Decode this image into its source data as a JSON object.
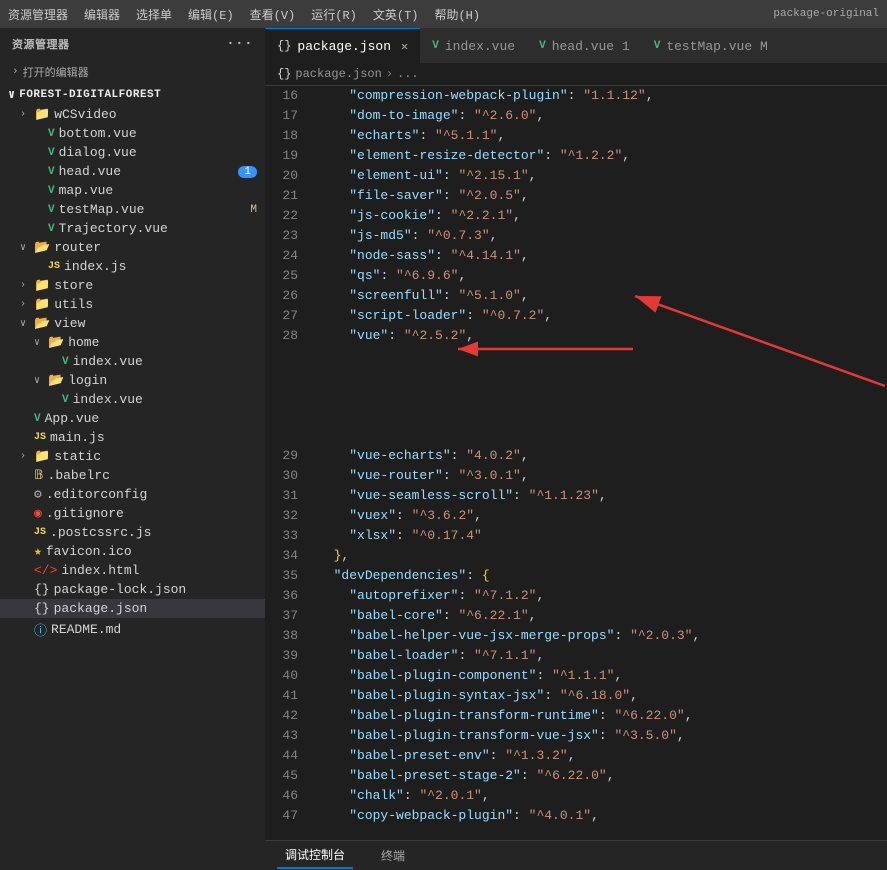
{
  "menubar": {
    "items": [
      "资源管理器",
      "编辑器",
      "选择单",
      "编辑(E)",
      "查看(V)",
      "运行(R)",
      "文英(T)",
      "帮助(H)",
      "package-original"
    ]
  },
  "sidebar": {
    "header": "资源管理器",
    "open_editors_label": "打开的编辑器",
    "project_root": "FOREST-DIGITALFOREST",
    "tree": [
      {
        "indent": 1,
        "type": "folder",
        "name": "wCSvideo",
        "collapsed": true
      },
      {
        "indent": 1,
        "type": "vue",
        "name": "bottom.vue"
      },
      {
        "indent": 1,
        "type": "vue",
        "name": "dialog.vue"
      },
      {
        "indent": 1,
        "type": "vue",
        "name": "head.vue",
        "badge": "1"
      },
      {
        "indent": 1,
        "type": "vue",
        "name": "map.vue"
      },
      {
        "indent": 1,
        "type": "vue",
        "name": "testMap.vue",
        "badge_m": "M"
      },
      {
        "indent": 1,
        "type": "vue",
        "name": "Trajectory.vue"
      },
      {
        "indent": 0,
        "type": "folder",
        "name": "router",
        "collapsed": false
      },
      {
        "indent": 1,
        "type": "js",
        "name": "index.js"
      },
      {
        "indent": 0,
        "type": "folder",
        "name": "store",
        "collapsed": true
      },
      {
        "indent": 0,
        "type": "folder",
        "name": "utils",
        "collapsed": true
      },
      {
        "indent": 0,
        "type": "folder",
        "name": "view",
        "collapsed": false
      },
      {
        "indent": 1,
        "type": "folder",
        "name": "home",
        "collapsed": false
      },
      {
        "indent": 2,
        "type": "vue",
        "name": "index.vue"
      },
      {
        "indent": 1,
        "type": "folder",
        "name": "login",
        "collapsed": false
      },
      {
        "indent": 2,
        "type": "vue",
        "name": "index.vue"
      },
      {
        "indent": 0,
        "type": "vue",
        "name": "App.vue"
      },
      {
        "indent": 0,
        "type": "js",
        "name": "main.js"
      },
      {
        "indent": 0,
        "type": "folder",
        "name": "static",
        "collapsed": true
      },
      {
        "indent": 0,
        "type": "babelrc",
        "name": ".babelrc"
      },
      {
        "indent": 0,
        "type": "editorconfig",
        "name": ".editorconfig"
      },
      {
        "indent": 0,
        "type": "gitignore",
        "name": ".gitignore"
      },
      {
        "indent": 0,
        "type": "js",
        "name": ".postcssrc.js"
      },
      {
        "indent": 0,
        "type": "favicon",
        "name": "favicon.ico"
      },
      {
        "indent": 0,
        "type": "html",
        "name": "index.html"
      },
      {
        "indent": 0,
        "type": "json",
        "name": "package-lock.json"
      },
      {
        "indent": 0,
        "type": "json",
        "name": "package.json",
        "selected": true
      },
      {
        "indent": 0,
        "type": "readme",
        "name": "README.md"
      }
    ]
  },
  "tabs": [
    {
      "name": "package.json",
      "type": "json",
      "active": true,
      "closeable": true
    },
    {
      "name": "index.vue",
      "type": "vue",
      "active": false,
      "closeable": false
    },
    {
      "name": "head.vue 1",
      "type": "vue",
      "active": false,
      "closeable": false
    },
    {
      "name": "testMap.vue M",
      "type": "vue",
      "active": false,
      "closeable": false
    }
  ],
  "breadcrumb": [
    "{} package.json",
    ">",
    "..."
  ],
  "code": {
    "lines": [
      {
        "num": 16,
        "content": "    \"compression-webpack-plugin\": \"1.1.12\","
      },
      {
        "num": 17,
        "content": "    \"dom-to-image\": \"^2.6.0\","
      },
      {
        "num": 18,
        "content": "    \"echarts\": \"^5.1.1\","
      },
      {
        "num": 19,
        "content": "    \"element-resize-detector\": \"^1.2.2\","
      },
      {
        "num": 20,
        "content": "    \"element-ui\": \"^2.15.1\","
      },
      {
        "num": 21,
        "content": "    \"file-saver\": \"^2.0.5\","
      },
      {
        "num": 22,
        "content": "    \"js-cookie\": \"^2.2.1\","
      },
      {
        "num": 23,
        "content": "    \"js-md5\": \"^0.7.3\","
      },
      {
        "num": 24,
        "content": "    \"node-sass\": \"^4.14.1\","
      },
      {
        "num": 25,
        "content": "    \"qs\": \"^6.9.6\","
      },
      {
        "num": 26,
        "content": "    \"screenfull\": \"^5.1.0\","
      },
      {
        "num": 27,
        "content": "    \"script-loader\": \"^0.7.2\","
      },
      {
        "num": 28,
        "content": "    \"vue\": \"^2.5.2\","
      },
      {
        "num": 29,
        "content": "    \"vue-echarts\": \"4.0.2\","
      },
      {
        "num": 30,
        "content": "    \"vue-router\": \"^3.0.1\","
      },
      {
        "num": 31,
        "content": "    \"vue-seamless-scroll\": \"^1.1.23\","
      },
      {
        "num": 32,
        "content": "    \"vuex\": \"^3.6.2\","
      },
      {
        "num": 33,
        "content": "    \"xlsx\": \"^0.17.4\""
      },
      {
        "num": 34,
        "content": "  },"
      },
      {
        "num": 35,
        "content": "  \"devDependencies\": {"
      },
      {
        "num": 36,
        "content": "    \"autoprefixer\": \"^7.1.2\","
      },
      {
        "num": 37,
        "content": "    \"babel-core\": \"^6.22.1\","
      },
      {
        "num": 38,
        "content": "    \"babel-helper-vue-jsx-merge-props\": \"^2.0.3\","
      },
      {
        "num": 39,
        "content": "    \"babel-loader\": \"^7.1.1\","
      },
      {
        "num": 40,
        "content": "    \"babel-plugin-component\": \"^1.1.1\","
      },
      {
        "num": 41,
        "content": "    \"babel-plugin-syntax-jsx\": \"^6.18.0\","
      },
      {
        "num": 42,
        "content": "    \"babel-plugin-transform-runtime\": \"^6.22.0\","
      },
      {
        "num": 43,
        "content": "    \"babel-plugin-transform-vue-jsx\": \"^3.5.0\","
      },
      {
        "num": 44,
        "content": "    \"babel-preset-env\": \"^1.3.2\","
      },
      {
        "num": 45,
        "content": "    \"babel-preset-stage-2\": \"^6.22.0\","
      },
      {
        "num": 46,
        "content": "    \"chalk\": \"^2.0.1\","
      },
      {
        "num": 47,
        "content": "    \"copy-webpack-plugin\": \"^4.0.1\","
      }
    ]
  },
  "bottom_panel": {
    "tabs": [
      "调试控制台",
      "终端"
    ]
  }
}
